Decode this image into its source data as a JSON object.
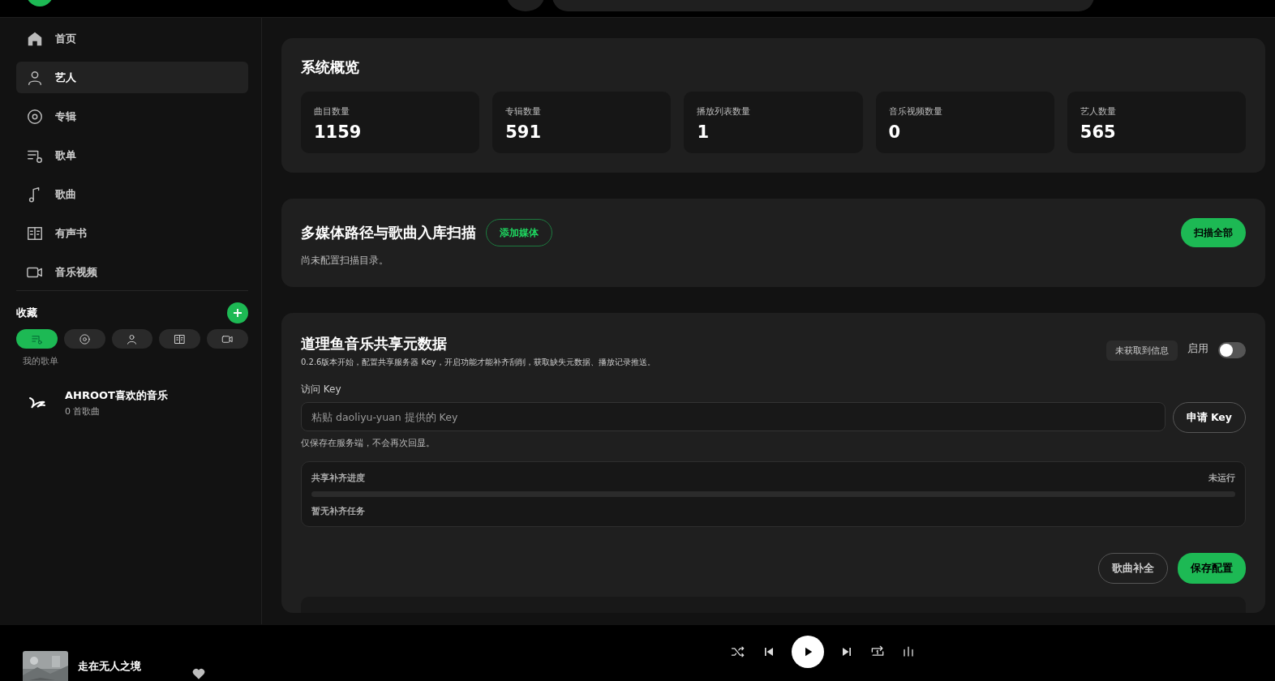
{
  "sidebar": {
    "nav": [
      {
        "kind": "home",
        "label": "首页",
        "selected": false
      },
      {
        "kind": "person",
        "label": "艺人",
        "selected": true
      },
      {
        "kind": "disc",
        "label": "专辑",
        "selected": false
      },
      {
        "kind": "playlist",
        "label": "歌单",
        "selected": false
      },
      {
        "kind": "note",
        "label": "歌曲",
        "selected": false
      },
      {
        "kind": "book",
        "label": "有声书",
        "selected": false
      },
      {
        "kind": "video",
        "label": "音乐视频",
        "selected": false
      }
    ],
    "favorites": {
      "title": "收藏",
      "filters": [
        {
          "kind": "playlist",
          "selected": true
        },
        {
          "kind": "disc",
          "selected": false
        },
        {
          "kind": "person",
          "selected": false
        },
        {
          "kind": "book",
          "selected": false
        },
        {
          "kind": "video",
          "selected": false
        }
      ],
      "section_label": "我的歌单",
      "playlists": [
        {
          "name": "AHROOT喜欢的音乐",
          "subtitle": "0 首歌曲"
        }
      ]
    }
  },
  "overview": {
    "title": "系统概览",
    "stats": [
      {
        "label": "曲目数量",
        "value": "1159"
      },
      {
        "label": "专辑数量",
        "value": "591"
      },
      {
        "label": "播放列表数量",
        "value": "1"
      },
      {
        "label": "音乐视频数量",
        "value": "0"
      },
      {
        "label": "艺人数量",
        "value": "565"
      }
    ]
  },
  "media": {
    "title": "多媒体路径与歌曲入库扫描",
    "add_button": "添加媒体",
    "scan_button": "扫描全部",
    "empty_text": "尚未配置扫描目录。"
  },
  "share": {
    "title": "道理鱼音乐共享元数据",
    "description": "0.2.6版本开始，配置共享服务器 Key，开启功能才能补齐刮削，获取缺失元数据、播放记录推送。",
    "status_badge": "未获取到信息",
    "enable_label": "启用",
    "enabled": false,
    "key_label": "访问 Key",
    "key_placeholder": "粘贴 daoliyu-yuan 提供的 Key",
    "apply_button": "申请 Key",
    "hint": "仅保存在服务端，不会再次回显。",
    "progress": {
      "title": "共享补齐进度",
      "state": "未运行",
      "level": 0,
      "empty_text": "暂无补齐任务"
    },
    "buttons": [
      {
        "kind": "secondary",
        "label": "歌曲补全"
      },
      {
        "kind": "primary",
        "label": "保存配置"
      }
    ]
  },
  "player": {
    "title": "走在无人之境",
    "liked": false,
    "playing": false
  }
}
